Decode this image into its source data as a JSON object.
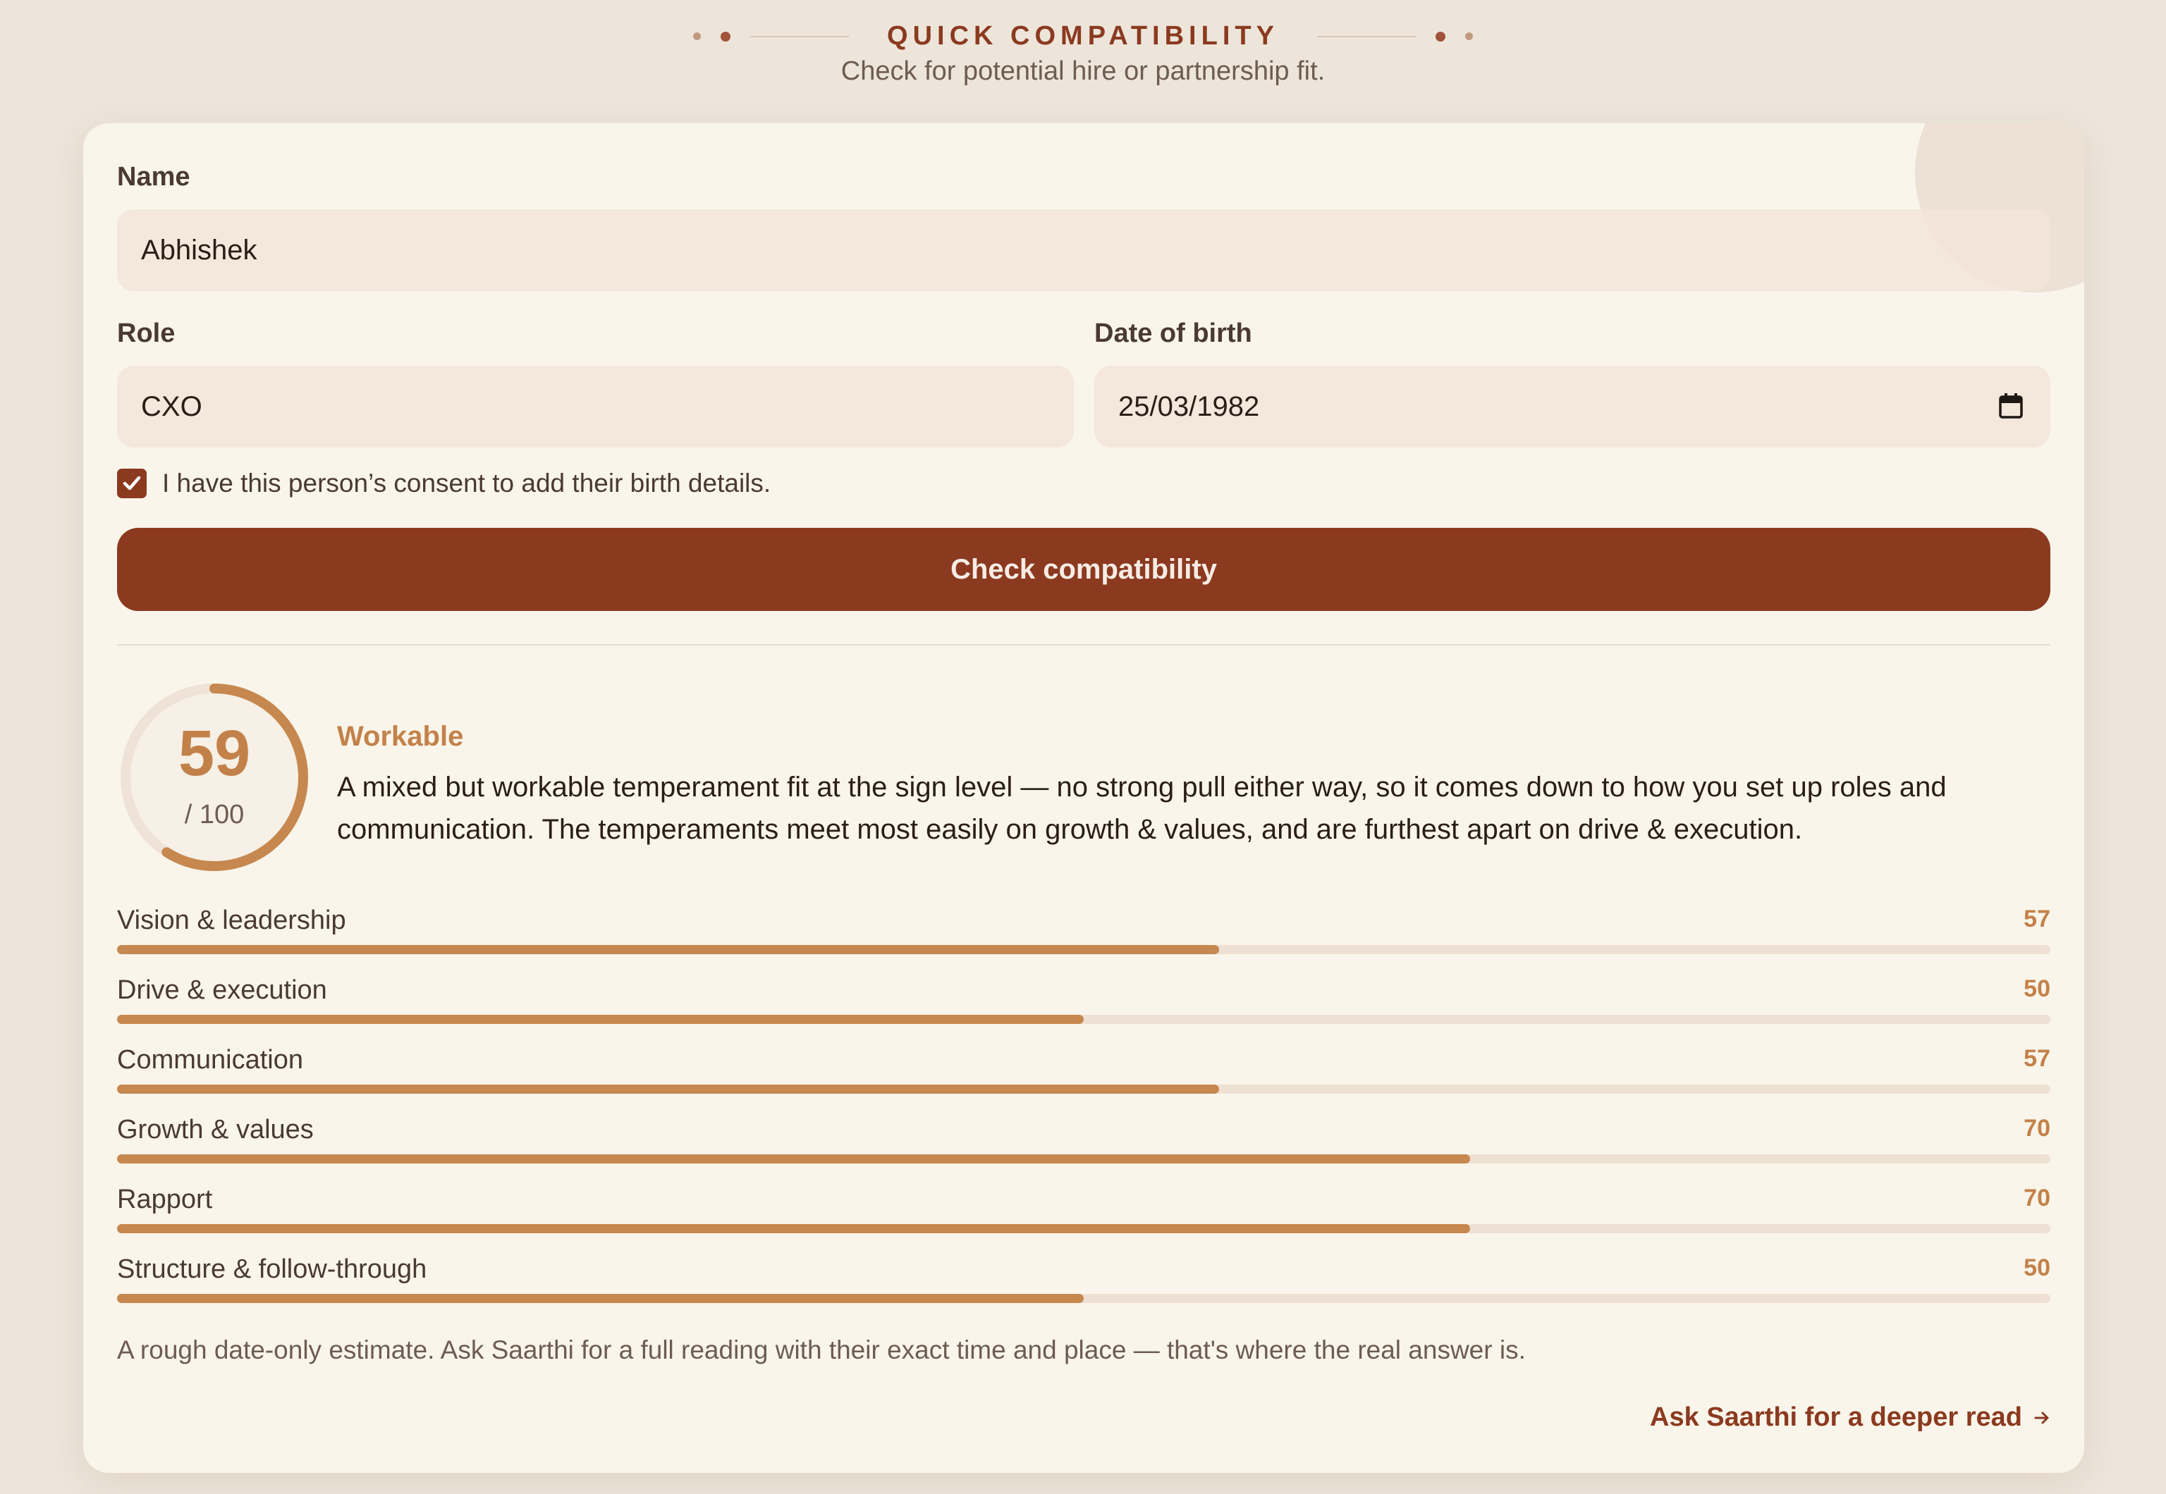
{
  "header": {
    "eyebrow": "QUICK COMPATIBILITY",
    "subtitle": "Check for potential hire or partnership fit."
  },
  "form": {
    "name_label": "Name",
    "name_value": "Abhishek",
    "role_label": "Role",
    "role_value": "CXO",
    "dob_label": "Date of birth",
    "dob_value": "25/03/1982",
    "consent_checked": true,
    "consent_text": "I have this person’s consent to add their birth details.",
    "submit_label": "Check compatibility"
  },
  "result": {
    "score": "59",
    "score_value": 59,
    "score_total": "/ 100",
    "verdict": "Workable",
    "summary": "A mixed but workable temperament fit at the sign level — no strong pull either way, so it comes down to how you set up roles and communication. The temperaments meet most easily on growth & values, and are furthest apart on drive & execution.",
    "metrics": [
      {
        "label": "Vision & leadership",
        "score": "57",
        "value": 57
      },
      {
        "label": "Drive & execution",
        "score": "50",
        "value": 50
      },
      {
        "label": "Communication",
        "score": "57",
        "value": 57
      },
      {
        "label": "Growth & values",
        "score": "70",
        "value": 70
      },
      {
        "label": "Rapport",
        "score": "70",
        "value": 70
      },
      {
        "label": "Structure & follow-through",
        "score": "50",
        "value": 50
      }
    ],
    "footnote": "A rough date-only estimate. Ask Saarthi for a full reading with their exact time and place — that's where the real answer is.",
    "cta_label": "Ask Saarthi for a deeper read"
  },
  "colors": {
    "accent": "#8b3a20",
    "gauge": "#c6884f",
    "background": "#ede5da",
    "card": "#f9f5ea"
  },
  "icons": {
    "calendar": "calendar-icon",
    "check": "checkmark-icon",
    "arrow": "arrow-right-icon"
  }
}
